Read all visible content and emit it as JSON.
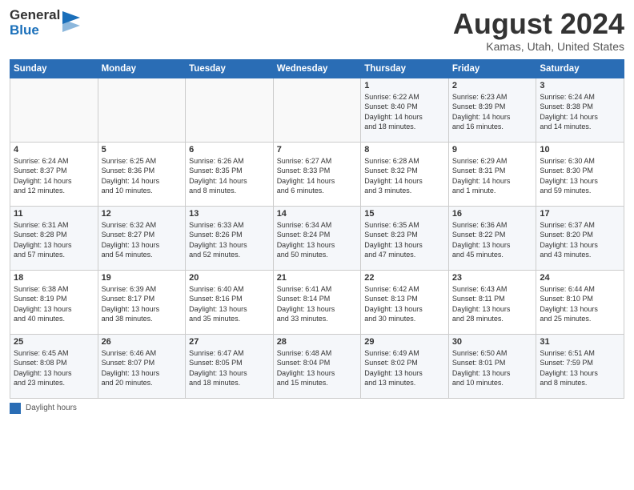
{
  "header": {
    "logo_general": "General",
    "logo_blue": "Blue",
    "title": "August 2024",
    "subtitle": "Kamas, Utah, United States"
  },
  "days_of_week": [
    "Sunday",
    "Monday",
    "Tuesday",
    "Wednesday",
    "Thursday",
    "Friday",
    "Saturday"
  ],
  "weeks": [
    [
      {
        "day": "",
        "info": ""
      },
      {
        "day": "",
        "info": ""
      },
      {
        "day": "",
        "info": ""
      },
      {
        "day": "",
        "info": ""
      },
      {
        "day": "1",
        "info": "Sunrise: 6:22 AM\nSunset: 8:40 PM\nDaylight: 14 hours\nand 18 minutes."
      },
      {
        "day": "2",
        "info": "Sunrise: 6:23 AM\nSunset: 8:39 PM\nDaylight: 14 hours\nand 16 minutes."
      },
      {
        "day": "3",
        "info": "Sunrise: 6:24 AM\nSunset: 8:38 PM\nDaylight: 14 hours\nand 14 minutes."
      }
    ],
    [
      {
        "day": "4",
        "info": "Sunrise: 6:24 AM\nSunset: 8:37 PM\nDaylight: 14 hours\nand 12 minutes."
      },
      {
        "day": "5",
        "info": "Sunrise: 6:25 AM\nSunset: 8:36 PM\nDaylight: 14 hours\nand 10 minutes."
      },
      {
        "day": "6",
        "info": "Sunrise: 6:26 AM\nSunset: 8:35 PM\nDaylight: 14 hours\nand 8 minutes."
      },
      {
        "day": "7",
        "info": "Sunrise: 6:27 AM\nSunset: 8:33 PM\nDaylight: 14 hours\nand 6 minutes."
      },
      {
        "day": "8",
        "info": "Sunrise: 6:28 AM\nSunset: 8:32 PM\nDaylight: 14 hours\nand 3 minutes."
      },
      {
        "day": "9",
        "info": "Sunrise: 6:29 AM\nSunset: 8:31 PM\nDaylight: 14 hours\nand 1 minute."
      },
      {
        "day": "10",
        "info": "Sunrise: 6:30 AM\nSunset: 8:30 PM\nDaylight: 13 hours\nand 59 minutes."
      }
    ],
    [
      {
        "day": "11",
        "info": "Sunrise: 6:31 AM\nSunset: 8:28 PM\nDaylight: 13 hours\nand 57 minutes."
      },
      {
        "day": "12",
        "info": "Sunrise: 6:32 AM\nSunset: 8:27 PM\nDaylight: 13 hours\nand 54 minutes."
      },
      {
        "day": "13",
        "info": "Sunrise: 6:33 AM\nSunset: 8:26 PM\nDaylight: 13 hours\nand 52 minutes."
      },
      {
        "day": "14",
        "info": "Sunrise: 6:34 AM\nSunset: 8:24 PM\nDaylight: 13 hours\nand 50 minutes."
      },
      {
        "day": "15",
        "info": "Sunrise: 6:35 AM\nSunset: 8:23 PM\nDaylight: 13 hours\nand 47 minutes."
      },
      {
        "day": "16",
        "info": "Sunrise: 6:36 AM\nSunset: 8:22 PM\nDaylight: 13 hours\nand 45 minutes."
      },
      {
        "day": "17",
        "info": "Sunrise: 6:37 AM\nSunset: 8:20 PM\nDaylight: 13 hours\nand 43 minutes."
      }
    ],
    [
      {
        "day": "18",
        "info": "Sunrise: 6:38 AM\nSunset: 8:19 PM\nDaylight: 13 hours\nand 40 minutes."
      },
      {
        "day": "19",
        "info": "Sunrise: 6:39 AM\nSunset: 8:17 PM\nDaylight: 13 hours\nand 38 minutes."
      },
      {
        "day": "20",
        "info": "Sunrise: 6:40 AM\nSunset: 8:16 PM\nDaylight: 13 hours\nand 35 minutes."
      },
      {
        "day": "21",
        "info": "Sunrise: 6:41 AM\nSunset: 8:14 PM\nDaylight: 13 hours\nand 33 minutes."
      },
      {
        "day": "22",
        "info": "Sunrise: 6:42 AM\nSunset: 8:13 PM\nDaylight: 13 hours\nand 30 minutes."
      },
      {
        "day": "23",
        "info": "Sunrise: 6:43 AM\nSunset: 8:11 PM\nDaylight: 13 hours\nand 28 minutes."
      },
      {
        "day": "24",
        "info": "Sunrise: 6:44 AM\nSunset: 8:10 PM\nDaylight: 13 hours\nand 25 minutes."
      }
    ],
    [
      {
        "day": "25",
        "info": "Sunrise: 6:45 AM\nSunset: 8:08 PM\nDaylight: 13 hours\nand 23 minutes."
      },
      {
        "day": "26",
        "info": "Sunrise: 6:46 AM\nSunset: 8:07 PM\nDaylight: 13 hours\nand 20 minutes."
      },
      {
        "day": "27",
        "info": "Sunrise: 6:47 AM\nSunset: 8:05 PM\nDaylight: 13 hours\nand 18 minutes."
      },
      {
        "day": "28",
        "info": "Sunrise: 6:48 AM\nSunset: 8:04 PM\nDaylight: 13 hours\nand 15 minutes."
      },
      {
        "day": "29",
        "info": "Sunrise: 6:49 AM\nSunset: 8:02 PM\nDaylight: 13 hours\nand 13 minutes."
      },
      {
        "day": "30",
        "info": "Sunrise: 6:50 AM\nSunset: 8:01 PM\nDaylight: 13 hours\nand 10 minutes."
      },
      {
        "day": "31",
        "info": "Sunrise: 6:51 AM\nSunset: 7:59 PM\nDaylight: 13 hours\nand 8 minutes."
      }
    ]
  ],
  "legend": {
    "box_label": "Daylight hours"
  }
}
